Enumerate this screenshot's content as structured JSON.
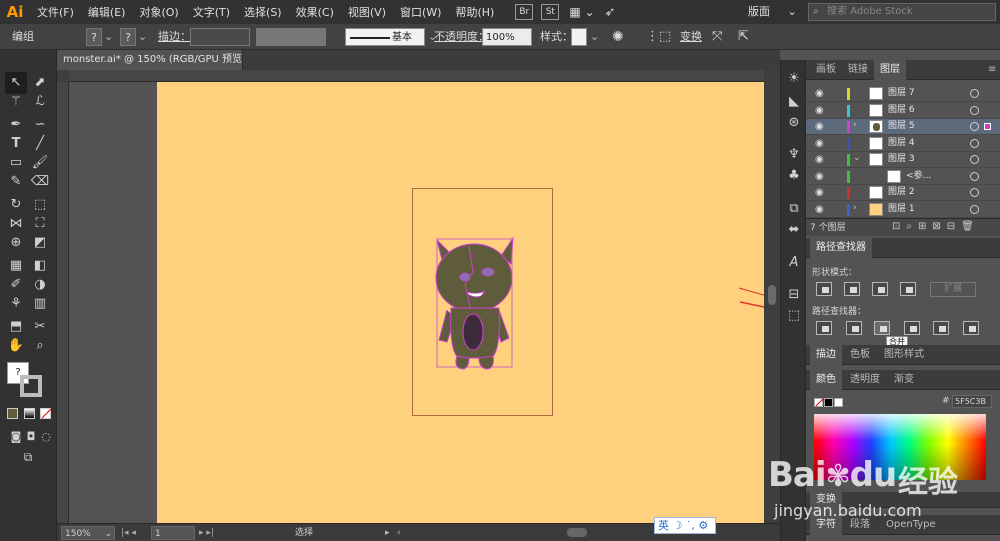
{
  "app": {
    "logo": "Ai"
  },
  "menu": {
    "items": [
      "文件(F)",
      "编辑(E)",
      "对象(O)",
      "文字(T)",
      "选择(S)",
      "效果(C)",
      "视图(V)",
      "窗口(W)",
      "帮助(H)"
    ],
    "bridge": "Br",
    "stock": "St",
    "workspace": "版面",
    "search_placeholder": "搜索 Adobe Stock"
  },
  "controlbar": {
    "label": "编组",
    "fill_q": "?",
    "stroke_q": "?",
    "stroke_label": "描边：",
    "stroke_profile": "基本",
    "opacity_label": "不透明度：",
    "opacity_value": "100%",
    "style_label": "样式：",
    "transform_label": "变换"
  },
  "document": {
    "tab_title": "monster.ai* @ 150% (RGB/GPU 预览)",
    "artboard_color": "#ffd07e"
  },
  "statusbar": {
    "zoom": "150%",
    "artboard_num": "1",
    "tool_name": "选择"
  },
  "ime": {
    "label": "英"
  },
  "panels": {
    "layers_tabs": [
      "画板",
      "链接",
      "图层"
    ],
    "layers": [
      {
        "name": "图层 7",
        "color": "#d8d830",
        "expand": "",
        "thumb": "blank",
        "selected": false
      },
      {
        "name": "图层 6",
        "color": "#30c8d8",
        "expand": "",
        "thumb": "blank",
        "selected": false
      },
      {
        "name": "图层 5",
        "color": "#d040d0",
        "expand": "›",
        "thumb": "monster",
        "selected": true
      },
      {
        "name": "图层 4",
        "color": "#4050c8",
        "expand": "",
        "thumb": "blank",
        "selected": false
      },
      {
        "name": "图层 3",
        "color": "#40c040",
        "expand": "⌄",
        "thumb": "blank",
        "selected": false
      },
      {
        "name": "<参...",
        "color": "#40c040",
        "expand": "",
        "thumb": "blank",
        "selected": false,
        "indent": true
      },
      {
        "name": "图层 2",
        "color": "#d03030",
        "expand": "",
        "thumb": "blank",
        "selected": false
      },
      {
        "name": "图层 1",
        "color": "#4060d0",
        "expand": "›",
        "thumb": "art",
        "selected": false
      }
    ],
    "layer_count": "7 个图层",
    "pathfinder_title": "路径查找器",
    "shape_modes_label": "形状模式：",
    "expand_button": "扩展",
    "pathfinders_label": "路径查找器：",
    "tooltip": "合并",
    "stroke_tabs": [
      "描边",
      "色板",
      "图形样式"
    ],
    "color_tabs": [
      "颜色",
      "透明度",
      "渐变"
    ],
    "hex_label": "#",
    "hex_value": "5F5C3B",
    "transform_tab": "变换",
    "type_tabs": [
      "字符",
      "段落",
      "OpenType"
    ]
  },
  "watermark": {
    "logo": "Bai",
    "logo_tail": "du",
    "cn": "经验",
    "url": "jingyan.baidu.com"
  }
}
